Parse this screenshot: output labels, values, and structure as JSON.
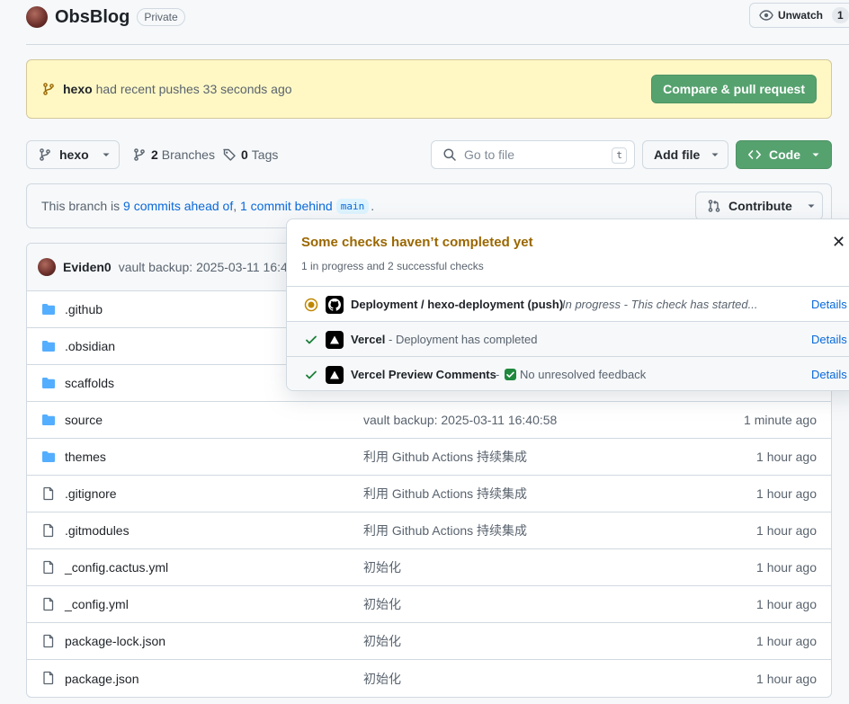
{
  "repo": {
    "name": "ObsBlog",
    "visibility": "Private"
  },
  "watch": {
    "label": "Unwatch",
    "count": "1"
  },
  "push_banner": {
    "branch": "hexo",
    "text": "had recent pushes 33 seconds ago",
    "button": "Compare & pull request"
  },
  "toolbar": {
    "branch": "hexo",
    "branches_count": "2",
    "branches_label": "Branches",
    "tags_count": "0",
    "tags_label": "Tags",
    "goto_placeholder": "Go to file",
    "goto_shortcut": "t",
    "add_file": "Add file",
    "code": "Code"
  },
  "branch_info": {
    "prefix": "This branch is",
    "ahead": "9 commits ahead of",
    "sep": ",",
    "behind": "1 commit behind",
    "base": "main",
    "suffix": ".",
    "contribute": "Contribute"
  },
  "latest_commit": {
    "author": "Eviden0",
    "message": "vault backup: 2025-03-11 16:40:58"
  },
  "files": [
    {
      "type": "dir",
      "name": ".github",
      "commit": "",
      "time": ""
    },
    {
      "type": "dir",
      "name": ".obsidian",
      "commit": "",
      "time": ""
    },
    {
      "type": "dir",
      "name": "scaffolds",
      "commit": "",
      "time": ""
    },
    {
      "type": "dir",
      "name": "source",
      "commit": "vault backup: 2025-03-11 16:40:58",
      "time": "1 minute ago"
    },
    {
      "type": "dir",
      "name": "themes",
      "commit": "利用 Github Actions 持续集成",
      "time": "1 hour ago"
    },
    {
      "type": "file",
      "name": ".gitignore",
      "commit": "利用 Github Actions 持续集成",
      "time": "1 hour ago"
    },
    {
      "type": "file",
      "name": ".gitmodules",
      "commit": "利用 Github Actions 持续集成",
      "time": "1 hour ago"
    },
    {
      "type": "file",
      "name": "_config.cactus.yml",
      "commit": "初始化",
      "time": "1 hour ago"
    },
    {
      "type": "file",
      "name": "_config.yml",
      "commit": "初始化",
      "time": "1 hour ago"
    },
    {
      "type": "file",
      "name": "package-lock.json",
      "commit": "初始化",
      "time": "1 hour ago"
    },
    {
      "type": "file",
      "name": "package.json",
      "commit": "初始化",
      "time": "1 hour ago"
    }
  ],
  "checks": {
    "title": "Some checks haven’t completed yet",
    "subtitle": "1 in progress and 2 successful checks",
    "items": [
      {
        "status": "in-progress",
        "name": "Deployment / hexo-deployment (push)",
        "description": "In progress - This check has started...",
        "details": "Details"
      },
      {
        "status": "success",
        "name": "Vercel",
        "description": "- Deployment has completed",
        "details": "Details"
      },
      {
        "status": "success",
        "name": "Vercel Preview Comments",
        "description_prefix": "-",
        "description": "No unresolved feedback",
        "details": "Details"
      }
    ]
  },
  "colors": {
    "primary_button": "#56a26f",
    "link": "#0969da",
    "warning_text": "#9a6700",
    "banner_bg": "#fff8c5"
  }
}
